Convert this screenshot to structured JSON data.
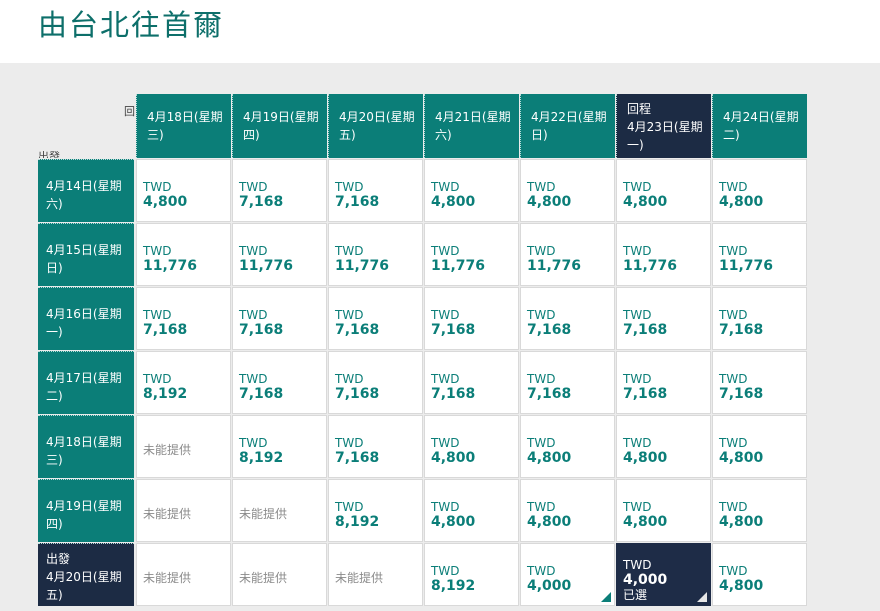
{
  "page_title": "由台北往首爾",
  "corner": {
    "return_label": "回",
    "depart_label": "出發"
  },
  "colors": {
    "accent": "#0b7e78",
    "selected": "#1c2b44"
  },
  "return_dates": [
    {
      "label": "4月18日(星期三)"
    },
    {
      "label": "4月19日(星期四)"
    },
    {
      "label": "4月20日(星期五)"
    },
    {
      "label": "4月21日(星期六)"
    },
    {
      "label": "4月22日(星期日)"
    },
    {
      "label": "4月23日(星期一)",
      "tag": "回程",
      "selected": true
    },
    {
      "label": "4月24日(星期二)"
    }
  ],
  "depart_dates": [
    {
      "label": "4月14日(星期六)"
    },
    {
      "label": "4月15日(星期日)"
    },
    {
      "label": "4月16日(星期一)"
    },
    {
      "label": "4月17日(星期二)"
    },
    {
      "label": "4月18日(星期三)"
    },
    {
      "label": "4月19日(星期四)"
    },
    {
      "label": "4月20日(星期五)",
      "tag": "出發",
      "selected": true
    }
  ],
  "currency": "TWD",
  "unavailable_text": "未能提供",
  "selected_text": "已選",
  "fares": [
    [
      "4,800",
      "7,168",
      "7,168",
      "4,800",
      "4,800",
      "4,800",
      "4,800"
    ],
    [
      "11,776",
      "11,776",
      "11,776",
      "11,776",
      "11,776",
      "11,776",
      "11,776"
    ],
    [
      "7,168",
      "7,168",
      "7,168",
      "7,168",
      "7,168",
      "7,168",
      "7,168"
    ],
    [
      "8,192",
      "7,168",
      "7,168",
      "7,168",
      "7,168",
      "7,168",
      "7,168"
    ],
    [
      null,
      "8,192",
      "7,168",
      "4,800",
      "4,800",
      "4,800",
      "4,800"
    ],
    [
      null,
      null,
      "8,192",
      "4,800",
      "4,800",
      "4,800",
      "4,800"
    ],
    [
      null,
      null,
      null,
      "8,192",
      "4,000",
      "4,000",
      "4,800"
    ]
  ],
  "lowest_fare_markers": [
    [
      6,
      4
    ],
    [
      6,
      5
    ]
  ],
  "selected_cell": [
    6,
    5
  ]
}
